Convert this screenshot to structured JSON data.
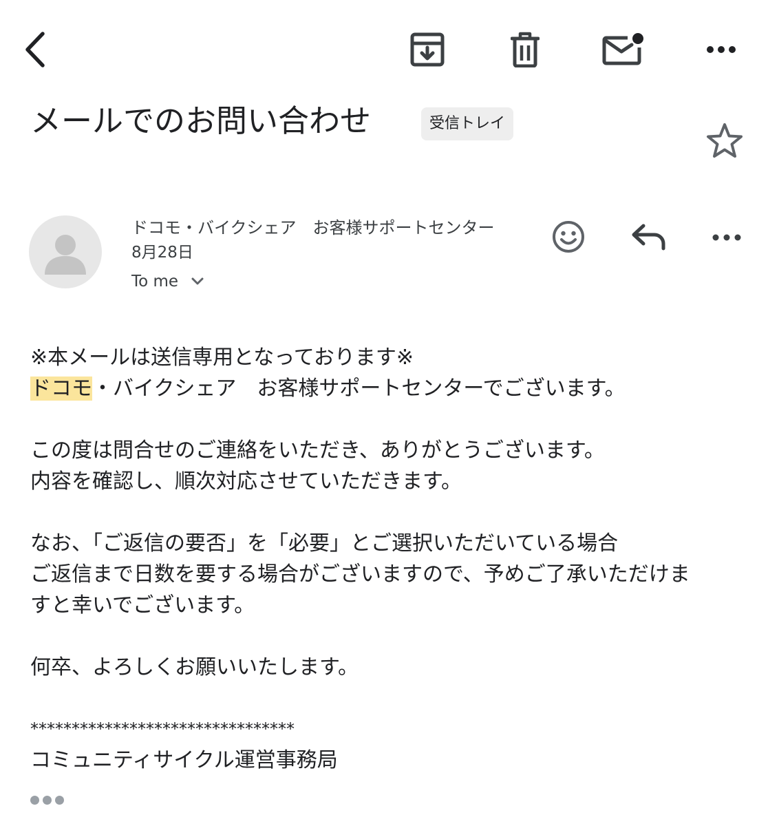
{
  "toolbar": {
    "back_icon": "arrow-back-icon",
    "archive_icon": "archive-icon",
    "delete_icon": "trash-icon",
    "mark_unread_icon": "mail-unread-icon",
    "more_icon": "more-horizontal-icon"
  },
  "email": {
    "subject": "メールでのお問い合わせ",
    "label": "受信トレイ",
    "starred": false
  },
  "sender": {
    "name": "ドコモ・バイクシェア　お客様サポートセンター",
    "date": "8月28日",
    "recipient": "To me"
  },
  "body": {
    "line1": "※本メールは送信専用となっております※",
    "line2_highlight": "ドコモ",
    "line2_rest": "・バイクシェア　お客様サポートセンターでございます。",
    "line3": "この度は問合せのご連絡をいただき、ありがとうございます。",
    "line4": "内容を確認し、順次対応させていただきます。",
    "line5": "なお、「ご返信の要否」を「必要」とご選択いただいている場合",
    "line6": "ご返信まで日数を要する場合がございますので、予めご了承いただけま",
    "line7": "すと幸いでございます。",
    "line8": "何卒、よろしくお願いいたします。",
    "line9": "********************************",
    "line10": "コミュニティサイクル運営事務局"
  },
  "colors": {
    "text": "#202124",
    "icon": "#3c4043",
    "highlight": "#fbe59c",
    "chip": "#eeeeee",
    "avatar": "#e7e7e7"
  }
}
